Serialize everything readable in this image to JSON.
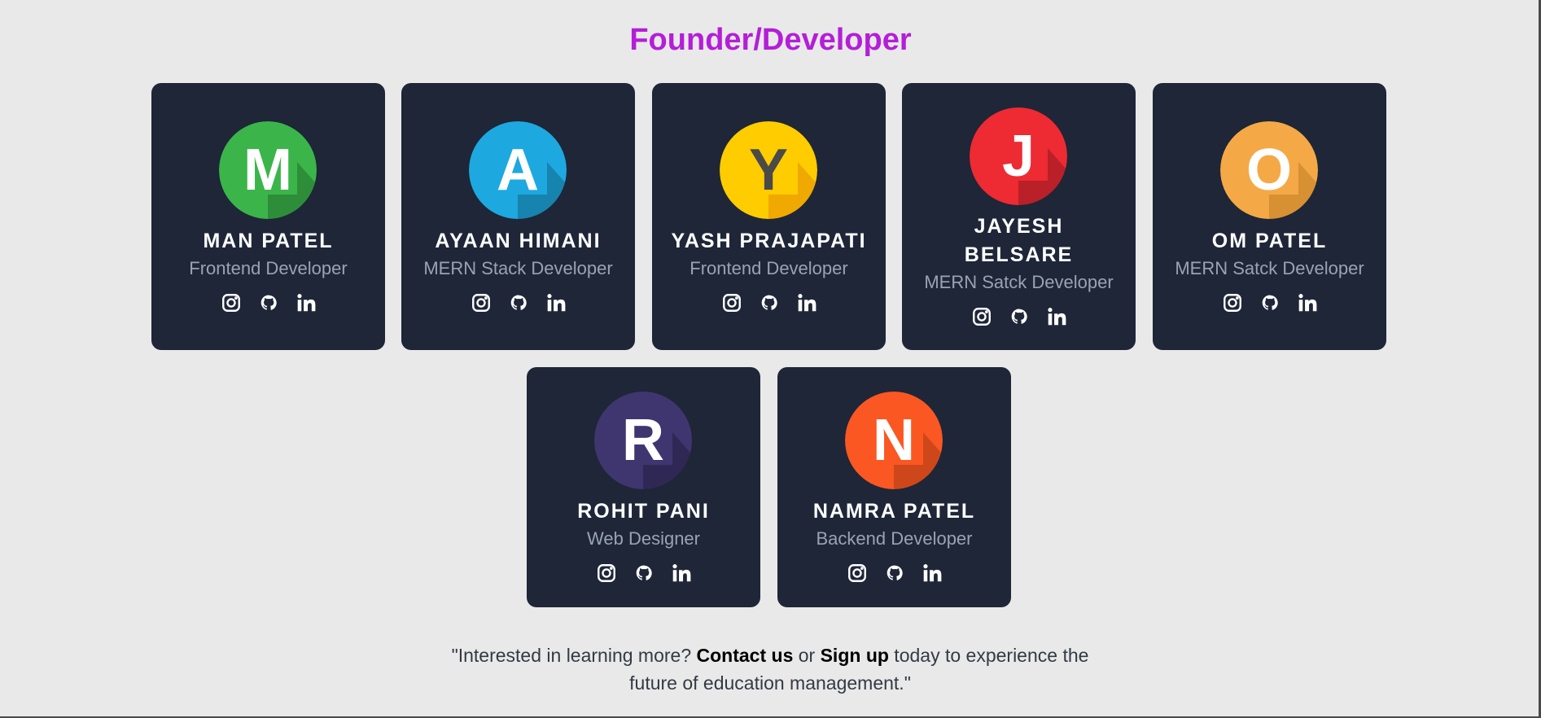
{
  "page": {
    "title": "Founder/Developer",
    "title_color": "#b41ed8",
    "card_background": "#1e2638",
    "role_color": "#9aa3b2"
  },
  "team": [
    {
      "initial": "M",
      "name": "MAN PATEL",
      "role": "Frontend Developer",
      "avatar_color": "#3bb54a",
      "socials": [
        "instagram-icon",
        "github-icon",
        "linkedin-icon"
      ]
    },
    {
      "initial": "A",
      "name": "AYAAN HIMANI",
      "role": "MERN Stack Developer",
      "avatar_color": "#1ea8e0",
      "socials": [
        "instagram-icon",
        "github-icon",
        "linkedin-icon"
      ]
    },
    {
      "initial": "Y",
      "name": "YASH PRAJAPATI",
      "role": "Frontend Developer",
      "avatar_color": "#ffcc00",
      "socials": [
        "instagram-icon",
        "github-icon",
        "linkedin-icon"
      ]
    },
    {
      "name_line1": "JAYESH",
      "name_line2": "BELSARE",
      "initial": "J",
      "role": "MERN Satck Developer",
      "avatar_color": "#ee2a32",
      "socials": [
        "instagram-icon",
        "github-icon",
        "linkedin-icon"
      ]
    },
    {
      "initial": "O",
      "name": "OM PATEL",
      "role": "MERN Satck Developer",
      "avatar_color": "#f4a946",
      "socials": [
        "instagram-icon",
        "github-icon",
        "linkedin-icon"
      ]
    },
    {
      "initial": "R",
      "name": "ROHIT PANI",
      "role": "Web Designer",
      "avatar_color": "#3f3670",
      "socials": [
        "instagram-icon",
        "github-icon",
        "linkedin-icon"
      ]
    },
    {
      "initial": "N",
      "name": "NAMRA PATEL",
      "role": "Backend Developer",
      "avatar_color": "#fb5722",
      "socials": [
        "instagram-icon",
        "github-icon",
        "linkedin-icon"
      ]
    }
  ],
  "footer": {
    "prefix": "\"Interested in learning more? ",
    "contact": "Contact us",
    "or": " or ",
    "signup": "Sign up",
    "suffix": " today to experience the future of education management.\""
  }
}
